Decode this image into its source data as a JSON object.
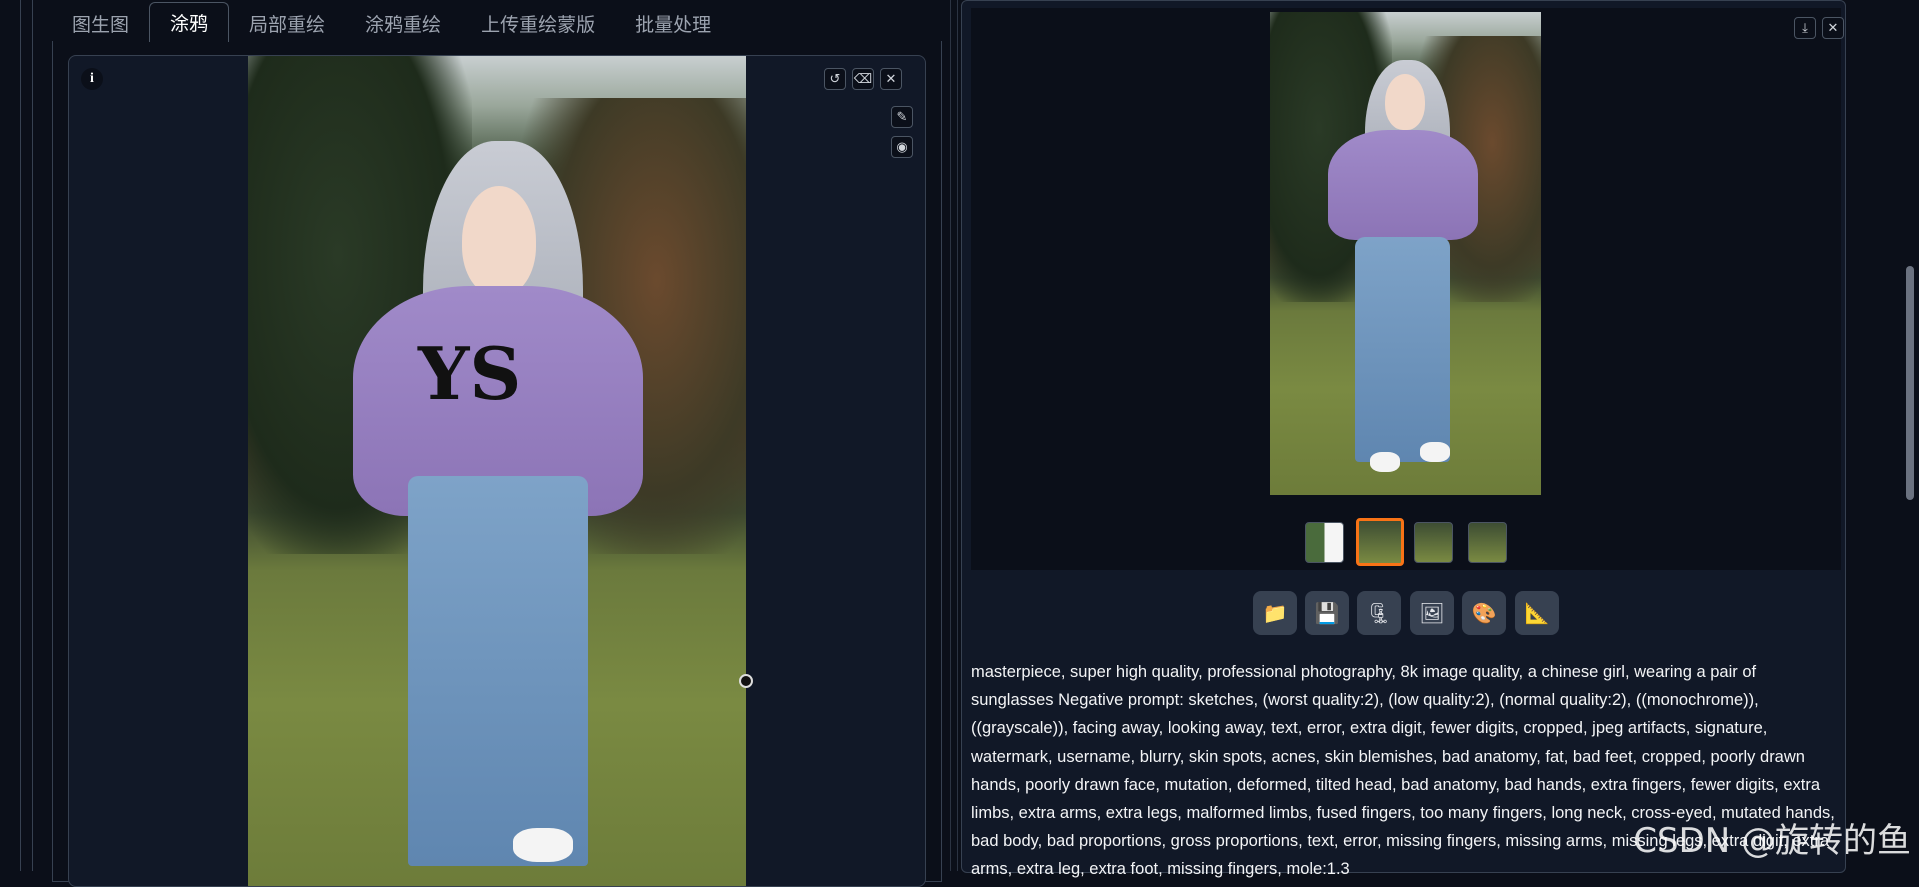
{
  "tabs": [
    {
      "label": "图生图"
    },
    {
      "label": "涂鸦"
    },
    {
      "label": "局部重绘"
    },
    {
      "label": "涂鸦重绘"
    },
    {
      "label": "上传重绘蒙版"
    },
    {
      "label": "批量处理"
    }
  ],
  "active_tab": "涂鸦",
  "canvas": {
    "info_icon": "i",
    "icons": [
      "undo-icon",
      "eraser-icon",
      "close-icon",
      "brush-icon",
      "palette-icon"
    ],
    "sweater_text": "YS"
  },
  "output": {
    "icons": [
      "download-icon",
      "close-icon"
    ],
    "thumbnails": 4,
    "selected_thumbnail": 2,
    "actions": [
      {
        "name": "open-folder",
        "glyph": "📁"
      },
      {
        "name": "save",
        "glyph": "💾"
      },
      {
        "name": "zip",
        "glyph": "🗜"
      },
      {
        "name": "send-to-img2img",
        "glyph": "🖼"
      },
      {
        "name": "send-to-inpaint",
        "glyph": "🎨"
      },
      {
        "name": "send-to-extras",
        "glyph": "📐"
      }
    ],
    "prompt_text": "masterpiece, super high quality, professional photography, 8k image quality, a chinese girl, wearing a pair of sunglasses Negative prompt: sketches, (worst quality:2), (low quality:2), (normal quality:2), ((monochrome)), ((grayscale)), facing away, looking away, text, error, extra digit, fewer digits, cropped, jpeg artifacts, signature, watermark, username, blurry, skin spots, acnes, skin blemishes, bad anatomy, fat, bad feet, cropped, poorly drawn hands, poorly drawn face, mutation, deformed, tilted head, bad anatomy, bad hands, extra fingers, fewer digits, extra limbs, extra arms, extra legs, malformed limbs, fused fingers, too many fingers, long neck, cross-eyed, mutated hands, bad body, bad proportions, gross proportions, text, error, missing fingers, missing arms, missing legs, extra digit, extra arms, extra leg, extra foot, missing fingers, mole:1.3"
  },
  "watermark": "CSDN @旋转的鱼"
}
